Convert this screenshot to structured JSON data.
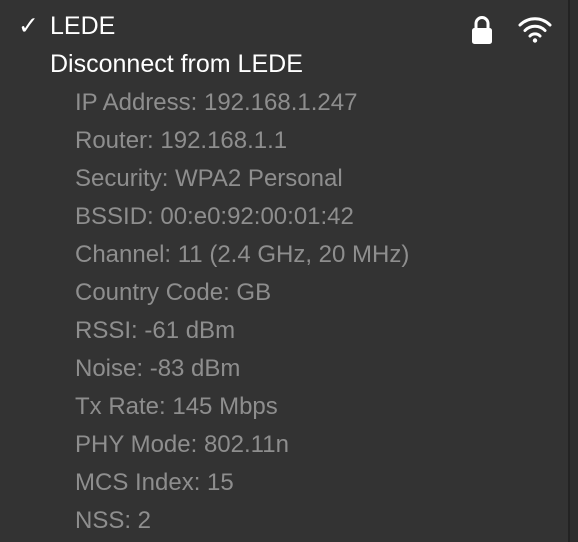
{
  "network": {
    "check_glyph": "✓",
    "name": "LEDE",
    "lock_icon": "lock-icon",
    "wifi_icon": "wifi-icon"
  },
  "disconnect_label": "Disconnect from LEDE",
  "details": [
    "IP Address: 192.168.1.247",
    "Router: 192.168.1.1",
    "Security: WPA2 Personal",
    "BSSID: 00:e0:92:00:01:42",
    "Channel: 11 (2.4 GHz, 20 MHz)",
    "Country Code: GB",
    "RSSI: -61 dBm",
    "Noise: -83 dBm",
    "Tx Rate: 145 Mbps",
    "PHY Mode: 802.11n",
    "MCS Index: 15",
    "NSS: 2"
  ]
}
